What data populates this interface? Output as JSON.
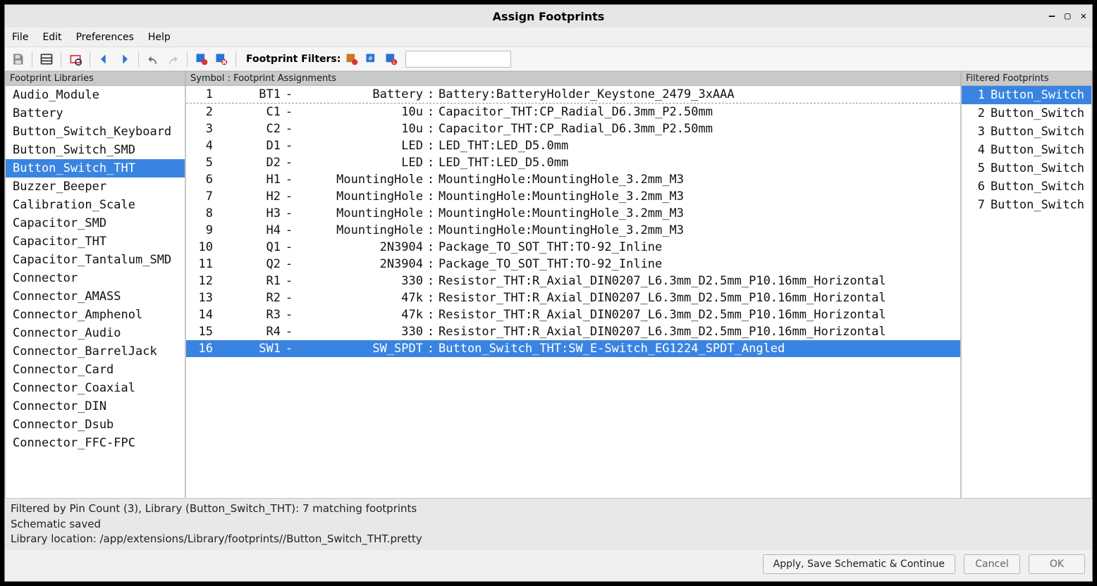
{
  "window": {
    "title": "Assign Footprints"
  },
  "menu": {
    "file": "File",
    "edit": "Edit",
    "preferences": "Preferences",
    "help": "Help"
  },
  "toolbar": {
    "filters_label": "Footprint Filters:",
    "search_placeholder": ""
  },
  "panels": {
    "libraries_title": "Footprint Libraries",
    "assignments_title": "Symbol : Footprint Assignments",
    "filtered_title": "Filtered Footprints"
  },
  "libraries": [
    "Audio_Module",
    "Battery",
    "Button_Switch_Keyboard",
    "Button_Switch_SMD",
    "Button_Switch_THT",
    "Buzzer_Beeper",
    "Calibration_Scale",
    "Capacitor_SMD",
    "Capacitor_THT",
    "Capacitor_Tantalum_SMD",
    "Connector",
    "Connector_AMASS",
    "Connector_Amphenol",
    "Connector_Audio",
    "Connector_BarrelJack",
    "Connector_Card",
    "Connector_Coaxial",
    "Connector_DIN",
    "Connector_Dsub",
    "Connector_FFC-FPC"
  ],
  "libraries_selected": 4,
  "assignments": [
    {
      "idx": "1",
      "ref": "BT1",
      "value": "Battery",
      "fp": "Battery:BatteryHolder_Keystone_2479_3xAAA"
    },
    {
      "idx": "2",
      "ref": "C1",
      "value": "10u",
      "fp": "Capacitor_THT:CP_Radial_D6.3mm_P2.50mm"
    },
    {
      "idx": "3",
      "ref": "C2",
      "value": "10u",
      "fp": "Capacitor_THT:CP_Radial_D6.3mm_P2.50mm"
    },
    {
      "idx": "4",
      "ref": "D1",
      "value": "LED",
      "fp": "LED_THT:LED_D5.0mm"
    },
    {
      "idx": "5",
      "ref": "D2",
      "value": "LED",
      "fp": "LED_THT:LED_D5.0mm"
    },
    {
      "idx": "6",
      "ref": "H1",
      "value": "MountingHole",
      "fp": "MountingHole:MountingHole_3.2mm_M3"
    },
    {
      "idx": "7",
      "ref": "H2",
      "value": "MountingHole",
      "fp": "MountingHole:MountingHole_3.2mm_M3"
    },
    {
      "idx": "8",
      "ref": "H3",
      "value": "MountingHole",
      "fp": "MountingHole:MountingHole_3.2mm_M3"
    },
    {
      "idx": "9",
      "ref": "H4",
      "value": "MountingHole",
      "fp": "MountingHole:MountingHole_3.2mm_M3"
    },
    {
      "idx": "10",
      "ref": "Q1",
      "value": "2N3904",
      "fp": "Package_TO_SOT_THT:TO-92_Inline"
    },
    {
      "idx": "11",
      "ref": "Q2",
      "value": "2N3904",
      "fp": "Package_TO_SOT_THT:TO-92_Inline"
    },
    {
      "idx": "12",
      "ref": "R1",
      "value": "330",
      "fp": "Resistor_THT:R_Axial_DIN0207_L6.3mm_D2.5mm_P10.16mm_Horizontal"
    },
    {
      "idx": "13",
      "ref": "R2",
      "value": "47k",
      "fp": "Resistor_THT:R_Axial_DIN0207_L6.3mm_D2.5mm_P10.16mm_Horizontal"
    },
    {
      "idx": "14",
      "ref": "R3",
      "value": "47k",
      "fp": "Resistor_THT:R_Axial_DIN0207_L6.3mm_D2.5mm_P10.16mm_Horizontal"
    },
    {
      "idx": "15",
      "ref": "R4",
      "value": "330",
      "fp": "Resistor_THT:R_Axial_DIN0207_L6.3mm_D2.5mm_P10.16mm_Horizontal"
    },
    {
      "idx": "16",
      "ref": "SW1",
      "value": "SW_SPDT",
      "fp": "Button_Switch_THT:SW_E-Switch_EG1224_SPDT_Angled"
    }
  ],
  "assignments_selected": 15,
  "filtered": [
    {
      "n": "1",
      "name": "Button_Switch"
    },
    {
      "n": "2",
      "name": "Button_Switch"
    },
    {
      "n": "3",
      "name": "Button_Switch"
    },
    {
      "n": "4",
      "name": "Button_Switch"
    },
    {
      "n": "5",
      "name": "Button_Switch"
    },
    {
      "n": "6",
      "name": "Button_Switch"
    },
    {
      "n": "7",
      "name": "Button_Switch"
    }
  ],
  "filtered_selected": 0,
  "status": {
    "line1": "Filtered by Pin Count (3), Library (Button_Switch_THT): 7 matching footprints",
    "line2": "Schematic saved",
    "line3": "Library location: /app/extensions/Library/footprints//Button_Switch_THT.pretty"
  },
  "buttons": {
    "apply": "Apply, Save Schematic & Continue",
    "cancel": "Cancel",
    "ok": "OK"
  }
}
